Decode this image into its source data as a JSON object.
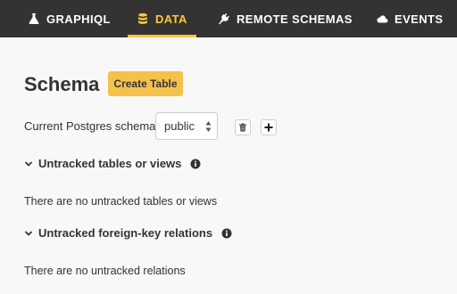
{
  "nav": {
    "tabs": [
      {
        "label": "GRAPHIQL",
        "icon": "flask-icon",
        "active": false
      },
      {
        "label": "DATA",
        "icon": "database-icon",
        "active": true
      },
      {
        "label": "REMOTE SCHEMAS",
        "icon": "plug-icon",
        "active": false
      },
      {
        "label": "EVENTS",
        "icon": "cloud-icon",
        "active": false
      }
    ]
  },
  "page": {
    "title": "Schema",
    "create_table_label": "Create Table"
  },
  "schema": {
    "label": "Current Postgres schema",
    "selected": "public"
  },
  "sections": [
    {
      "title": "Untracked tables or views",
      "empty_text": "There are no untracked tables or views"
    },
    {
      "title": "Untracked foreign-key relations",
      "empty_text": "There are no untracked relations"
    }
  ],
  "colors": {
    "nav_background": "#333333",
    "accent": "#fec53d",
    "button_background": "#f4c24a",
    "page_background": "#f8f8f8"
  }
}
